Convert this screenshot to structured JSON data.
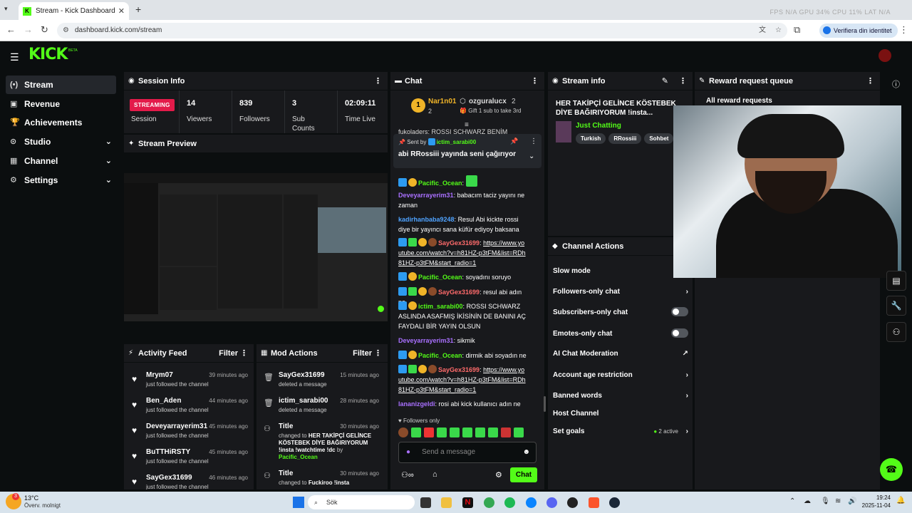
{
  "browser": {
    "tab_title": "Stream - Kick Dashboard",
    "url": "dashboard.kick.com/stream",
    "verify_label": "Verifiera din identitet",
    "perf": "FPS N/A   GPU 34%   CPU 11%   LAT N/A"
  },
  "header": {
    "logo": "KICK",
    "beta": "BETA"
  },
  "sidebar": {
    "items": [
      {
        "label": "Stream",
        "icon": "(•)"
      },
      {
        "label": "Revenue",
        "icon": "▣"
      },
      {
        "label": "Achievements",
        "icon": "🏆"
      },
      {
        "label": "Studio",
        "icon": "⊙"
      },
      {
        "label": "Channel",
        "icon": "▦"
      },
      {
        "label": "Settings",
        "icon": "⚙"
      }
    ]
  },
  "session": {
    "title": "Session Info",
    "status": "STREAMING",
    "session_label": "Session",
    "viewers": "14",
    "viewers_label": "Viewers",
    "followers": "839",
    "followers_label": "Followers",
    "subs": "3",
    "subs_label": "Sub Counts",
    "time": "02:09:11",
    "time_label": "Time Live"
  },
  "preview": {
    "title": "Stream Preview"
  },
  "activity": {
    "title": "Activity Feed",
    "filter": "Filter",
    "items": [
      {
        "name": "Mrym07",
        "sub": "just followed the channel",
        "time": "39 minutes ago"
      },
      {
        "name": "Ben_Aden",
        "sub": "just followed the channel",
        "time": "44 minutes ago"
      },
      {
        "name": "Deveyarrayerim31",
        "sub": "just followed the channel",
        "time": "45 minutes ago"
      },
      {
        "name": "BuTTHiRSTY",
        "sub": "just followed the channel",
        "time": "45 minutes ago"
      },
      {
        "name": "SayGex31699",
        "sub": "just followed the channel",
        "time": "46 minutes ago"
      }
    ]
  },
  "mod": {
    "title": "Mod Actions",
    "filter": "Filter",
    "items": [
      {
        "name": "SayGex31699",
        "sub": "deleted a message",
        "time": "15 minutes ago"
      },
      {
        "name": "ictim_sarabi00",
        "sub": "deleted a message",
        "time": "28 minutes ago"
      },
      {
        "name": "Title",
        "sub_pre": "changed to",
        "sub_title": "HER TAKİPÇİ GELİNCE KÖSTEBEK DİYE BAĞIRIYORUM !insta !watchtime !dc",
        "by": "by",
        "by_user": "Pacific_Ocean",
        "time": "30 minutes ago"
      },
      {
        "name": "Title",
        "sub_pre": "changed to",
        "sub_title": "Fuckiroo !insta",
        "time": "30 minutes ago"
      }
    ]
  },
  "chat": {
    "title": "Chat",
    "top_user": "Nar1n01",
    "top_user_count": "2",
    "gift_user": "ozguralucx",
    "gift_count": "2",
    "gift_text": "Gift 1 sub to take 3rd",
    "truncated": "fukoladers: ROSSI SCHWARZ BENİM",
    "pinned_by_label": "Sent by",
    "pinned_by": "ictim_sarabi00",
    "pinned_text": "abi RRossiii yayında seni çağırıyor",
    "messages": [
      {
        "user": "Pacific_Ocean",
        "text": "",
        "color": "#53fc18"
      },
      {
        "user": "Deveyarrayerim31",
        "text": "babacım taciz yayını ne zaman",
        "color": "#a970ff"
      },
      {
        "user": "kadirhanbaba9248",
        "text": "Resul Abi kickte rossi diye bir yayıncı sana küfür ediyoy baksana",
        "color": "#4fa3ff"
      },
      {
        "user": "SayGex31699",
        "text": "https://www.youtube.com/watch?v=h81HZ-p3tFM&list=RDh81HZ-p3tFM&start_radio=1",
        "color": "#ff6b6b"
      },
      {
        "user": "Pacific_Ocean",
        "text": "soyadını soruyo",
        "color": "#53fc18"
      },
      {
        "user": "SayGex31699",
        "text": "resul abi adın ne",
        "color": "#ff6b6b"
      },
      {
        "user": "ictim_sarabi00",
        "text": "ROSSI SCHWARZ ASLINDA ASAFMIŞ İKİSİNİN DE BANINI AÇ FAYDALI BİR YAYIN OLSUN",
        "color": "#53fc18"
      },
      {
        "user": "Deveyarrayerim31",
        "text": "sikmik",
        "color": "#a970ff"
      },
      {
        "user": "Pacific_Ocean",
        "text": "dirmik abi soyadın ne",
        "color": "#53fc18"
      },
      {
        "user": "SayGex31699",
        "text": "https://www.youtube.com/watch?v=h81HZ-p3tFM&list=RDh81HZ-p3tFM&start_radio=1",
        "color": "#ff6b6b"
      },
      {
        "user": "lananizgeldi",
        "text": "rosi abi kick kullanıcı adın ne",
        "color": "#a970ff"
      }
    ],
    "followers_only": "Followers only",
    "input_placeholder": "Send a message",
    "send_label": "Chat"
  },
  "stream_info": {
    "title": "Stream info",
    "stream_title": "HER TAKİPÇİ GELİNCE KÖSTEBEK DİYE BAĞIRIYORUM !insta...",
    "category": "Just Chatting",
    "tags": [
      "Turkish",
      "RRossiii",
      "Sohbet"
    ]
  },
  "reward": {
    "title": "Reward request queue",
    "all": "All reward requests"
  },
  "channel_actions": {
    "title": "Channel Actions",
    "items": [
      {
        "label": "Slow mode",
        "control": "none"
      },
      {
        "label": "Followers-only chat",
        "control": "chevron"
      },
      {
        "label": "Subscribers-only chat",
        "control": "toggle"
      },
      {
        "label": "Emotes-only chat",
        "control": "toggle"
      },
      {
        "label": "AI Chat Moderation",
        "control": "external"
      },
      {
        "label": "Account age restriction",
        "control": "chevron"
      },
      {
        "label": "Banned words",
        "control": "chevron"
      },
      {
        "label": "Host Channel",
        "control": "none"
      },
      {
        "label": "Set goals",
        "control": "chevron",
        "extra": "2 active"
      }
    ]
  },
  "taskbar": {
    "weather_temp": "13°C",
    "weather_desc": "Överv. molnigt",
    "notif_count": "3",
    "search": "Sök",
    "time": "19:24",
    "date": "2025-11-04"
  }
}
